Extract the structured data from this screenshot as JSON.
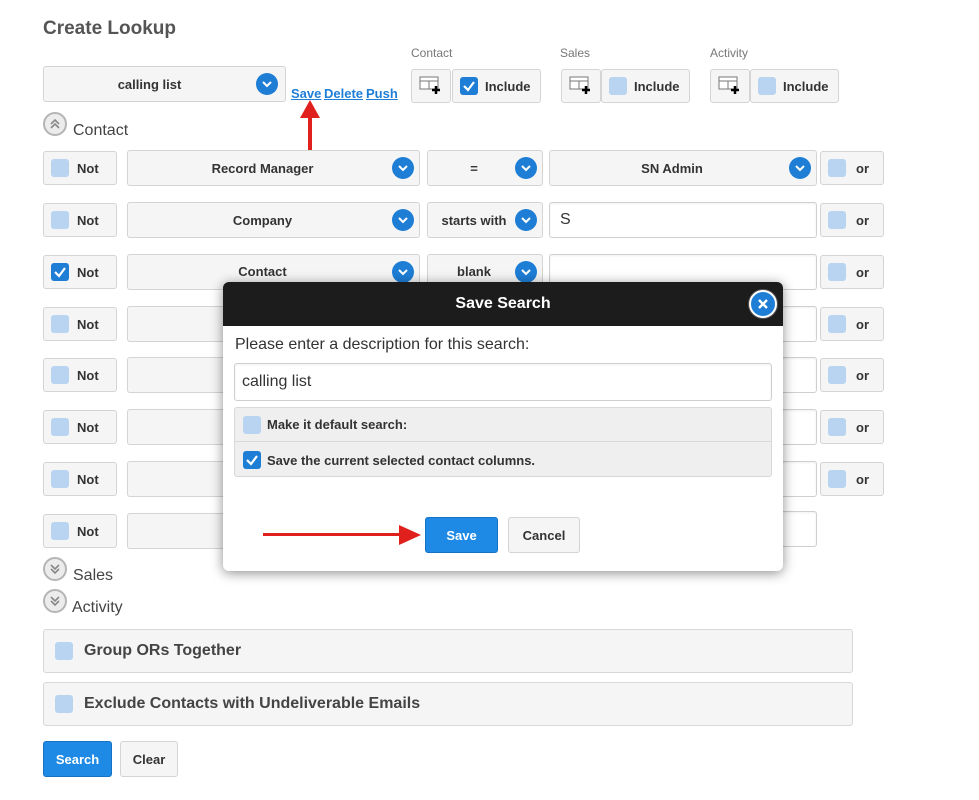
{
  "page": {
    "title": "Create Lookup"
  },
  "saved_search": {
    "value": "calling list",
    "links": [
      "Save",
      "Delete",
      "Push"
    ]
  },
  "include_groups": [
    {
      "label": "Contact",
      "include_label": "Include",
      "checked": true
    },
    {
      "label": "Sales",
      "include_label": "Include",
      "checked": false
    },
    {
      "label": "Activity",
      "include_label": "Include",
      "checked": false
    }
  ],
  "sections": {
    "contact": "Contact",
    "sales": "Sales",
    "activity": "Activity"
  },
  "filter_rows": [
    {
      "not_label": "Not",
      "not_checked": false,
      "field": "Record Manager",
      "operator": "=",
      "value": "SN Admin",
      "value_type": "select",
      "or_label": "or"
    },
    {
      "not_label": "Not",
      "not_checked": false,
      "field": "Company",
      "operator": "starts with",
      "value": "S",
      "value_type": "text",
      "or_label": "or"
    },
    {
      "not_label": "Not",
      "not_checked": true,
      "field": "Contact",
      "operator": "blank",
      "value": "",
      "value_type": "text",
      "or_label": "or"
    },
    {
      "not_label": "Not",
      "not_checked": false,
      "or_label": "or"
    },
    {
      "not_label": "Not",
      "not_checked": false,
      "or_label": "or"
    },
    {
      "not_label": "Not",
      "not_checked": false,
      "or_label": "or"
    },
    {
      "not_label": "Not",
      "not_checked": false,
      "or_label": "or"
    },
    {
      "not_label": "Not",
      "not_checked": false
    }
  ],
  "options": {
    "group_ors": "Group ORs Together",
    "exclude_undeliverable": "Exclude Contacts with Undeliverable Emails"
  },
  "actions": {
    "search": "Search",
    "clear": "Clear"
  },
  "modal": {
    "title": "Save Search",
    "prompt": "Please enter a description for this search:",
    "description_value": "calling list",
    "default_option": "Make it default search:",
    "default_checked": false,
    "columns_option": "Save the current selected contact columns.",
    "columns_checked": true,
    "save_label": "Save",
    "cancel_label": "Cancel"
  },
  "colors": {
    "accent": "#1e7ed6",
    "checkbox_off": "#b8d4f0",
    "annotation_arrow": "#e0201c",
    "modal_header": "#1c1c1c"
  }
}
